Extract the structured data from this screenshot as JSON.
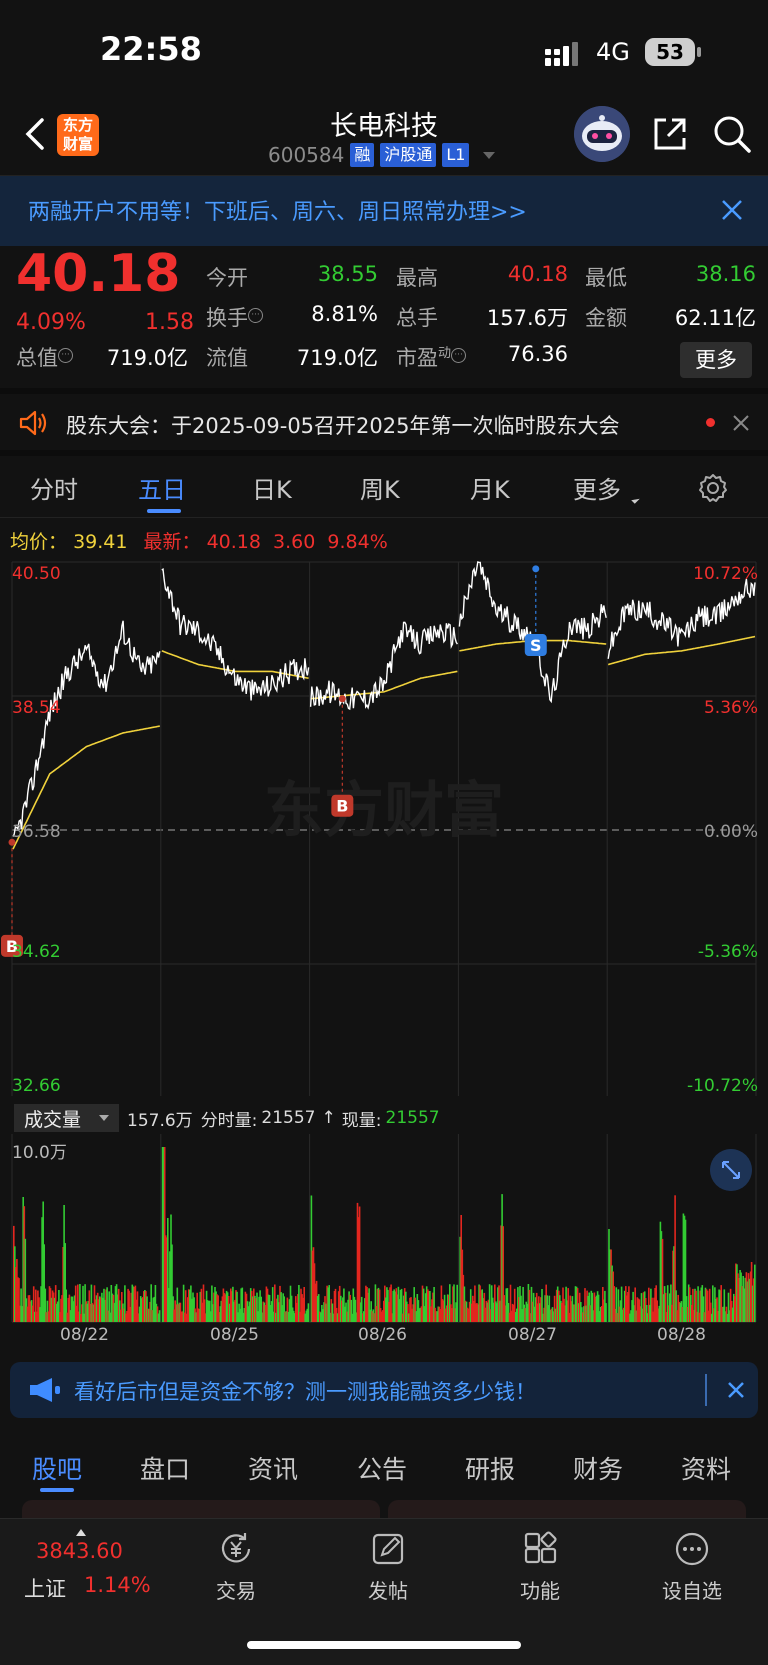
{
  "status": {
    "time": "22:58",
    "network": "4G",
    "battery": "53"
  },
  "header": {
    "logo_line1": "东方",
    "logo_line2": "财富",
    "stock_name": "长电科技",
    "stock_code": "600584",
    "tags": [
      "融",
      "沪股通",
      "L1"
    ]
  },
  "banner": {
    "text": "两融开户不用等！下班后、周六、周日照常办理>>"
  },
  "quote": {
    "price": "40.18",
    "change_pct": "4.09%",
    "change_amt": "1.58",
    "fields": {
      "open_label": "今开",
      "open": "38.55",
      "high_label": "最高",
      "high": "40.18",
      "low_label": "最低",
      "low": "38.16",
      "turnover_label": "换手",
      "turnover": "8.81%",
      "volume_label": "总手",
      "volume": "157.6万",
      "amount_label": "金额",
      "amount": "62.11亿",
      "mktcap_label": "总值",
      "mktcap": "719.0亿",
      "float_label": "流值",
      "float": "719.0亿",
      "pe_label": "市盈",
      "pe_sup": "动",
      "pe": "76.36"
    },
    "more": "更多"
  },
  "notice": {
    "text": "股东大会：于2025-09-05召开2025年第一次临时股东大会"
  },
  "chart_tabs": [
    "分时",
    "五日",
    "日K",
    "周K",
    "月K",
    "更多"
  ],
  "active_tab": "五日",
  "info_line": {
    "avg_label": "均价：",
    "avg": "39.41",
    "latest_label": "最新：",
    "latest": "40.18",
    "latest_chg": "3.60",
    "latest_pct": "9.84%"
  },
  "chart_data": {
    "type": "line",
    "title": "",
    "x": [
      "08/22",
      "08/25",
      "08/26",
      "08/27",
      "08/28"
    ],
    "y_left_ticks": [
      "40.50",
      "38.54",
      "36.58",
      "34.62",
      "32.66"
    ],
    "y_right_ticks": [
      "10.72%",
      "5.36%",
      "0.00%",
      "-5.36%",
      "-10.72%"
    ],
    "ylim": [
      32.66,
      40.5
    ],
    "reference_price": 36.58,
    "series": [
      {
        "name": "",
        "color": "#ffffff"
      },
      {
        "name": "均价",
        "color": "#f0d23c"
      }
    ],
    "markers": [
      {
        "label": "B",
        "day": "08/22"
      },
      {
        "label": "B",
        "day": "08/26"
      },
      {
        "label": "S",
        "day": "08/27"
      }
    ],
    "watermark": "东方财富"
  },
  "volume": {
    "select_label": "成交量",
    "total": "157.6万",
    "period_label": "分时量:",
    "period_value": "21557",
    "now_label": "现量:",
    "now_value": "21557",
    "scale": "10.0万"
  },
  "ad": {
    "text": "看好后市但是资金不够？测一测我能融资多少钱！"
  },
  "bottom_tabs": [
    "股吧",
    "盘口",
    "资讯",
    "公告",
    "研报",
    "财务",
    "资料"
  ],
  "active_bottom_tab": "股吧",
  "index": {
    "value": "3843.60",
    "name": "上证",
    "pct": "1.14%"
  },
  "nav": [
    "交易",
    "发帖",
    "功能",
    "设自选"
  ],
  "colors": {
    "up": "#f0302e",
    "down": "#33cc33",
    "accent": "#4a8cff",
    "avg_line": "#f0d23c"
  }
}
